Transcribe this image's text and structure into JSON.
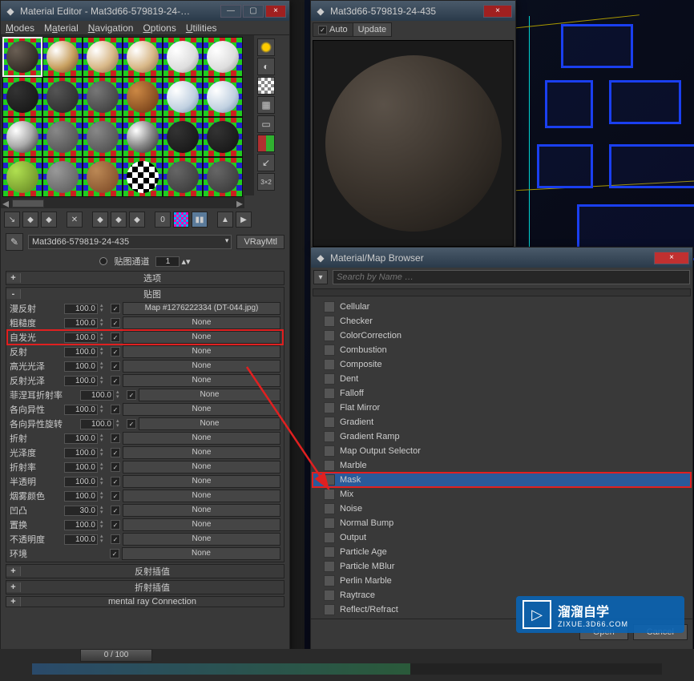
{
  "material_editor": {
    "title": "Material Editor - Mat3d66-579819-24-…",
    "menus": [
      "Modes",
      "Material",
      "Navigation",
      "Options",
      "Utilities"
    ],
    "material_name": "Mat3d66-579819-24-435",
    "material_type": "VRayMtl",
    "channel_label": "贴图通道",
    "channel_value": "1",
    "rollouts": {
      "options": {
        "sign": "+",
        "title": "选项"
      },
      "maps": {
        "sign": "-",
        "title": "贴图"
      },
      "refl_interp": {
        "sign": "+",
        "title": "反射插值"
      },
      "refr_interp": {
        "sign": "+",
        "title": "折射插值"
      },
      "mental_ray": {
        "sign": "+",
        "title": "mental ray Connection"
      }
    },
    "maps": [
      {
        "label": "漫反射",
        "amount": "100.0",
        "checked": true,
        "slot": "Map #1276222334 (DT-044.jpg)"
      },
      {
        "label": "粗糙度",
        "amount": "100.0",
        "checked": true,
        "slot": "None"
      },
      {
        "label": "自发光",
        "amount": "100.0",
        "checked": true,
        "slot": "None",
        "highlight": true
      },
      {
        "label": "反射",
        "amount": "100.0",
        "checked": true,
        "slot": "None"
      },
      {
        "label": "高光光泽",
        "amount": "100.0",
        "checked": true,
        "slot": "None"
      },
      {
        "label": "反射光泽",
        "amount": "100.0",
        "checked": true,
        "slot": "None"
      },
      {
        "label": "菲涅耳折射率",
        "amount": "100.0",
        "checked": true,
        "slot": "None",
        "indent": true
      },
      {
        "label": "各向异性",
        "amount": "100.0",
        "checked": true,
        "slot": "None"
      },
      {
        "label": "各向异性旋转",
        "amount": "100.0",
        "checked": true,
        "slot": "None",
        "indent": true
      },
      {
        "label": "折射",
        "amount": "100.0",
        "checked": true,
        "slot": "None"
      },
      {
        "label": "光泽度",
        "amount": "100.0",
        "checked": true,
        "slot": "None"
      },
      {
        "label": "折射率",
        "amount": "100.0",
        "checked": true,
        "slot": "None"
      },
      {
        "label": "半透明",
        "amount": "100.0",
        "checked": true,
        "slot": "None"
      },
      {
        "label": "烟雾颜色",
        "amount": "100.0",
        "checked": true,
        "slot": "None"
      },
      {
        "label": "凹凸",
        "amount": "30.0",
        "checked": true,
        "slot": "None"
      },
      {
        "label": "置换",
        "amount": "100.0",
        "checked": true,
        "slot": "None"
      },
      {
        "label": "不透明度",
        "amount": "100.0",
        "checked": true,
        "slot": "None"
      },
      {
        "label": "环境",
        "amount": "",
        "checked": true,
        "slot": "None",
        "no_amount": true
      }
    ]
  },
  "preview": {
    "title": "Mat3d66-579819-24-435",
    "auto": "Auto",
    "update": "Update",
    "auto_checked": true
  },
  "browser": {
    "title": "Material/Map Browser",
    "search_placeholder": "Search by Name …",
    "items": [
      {
        "name": "Cellular"
      },
      {
        "name": "Checker"
      },
      {
        "name": "ColorCorrection"
      },
      {
        "name": "Combustion"
      },
      {
        "name": "Composite"
      },
      {
        "name": "Dent"
      },
      {
        "name": "Falloff"
      },
      {
        "name": "Flat Mirror"
      },
      {
        "name": "Gradient"
      },
      {
        "name": "Gradient Ramp"
      },
      {
        "name": "Map Output Selector"
      },
      {
        "name": "Marble"
      },
      {
        "name": "Mask",
        "selected": true,
        "highlight": true
      },
      {
        "name": "Mix"
      },
      {
        "name": "Noise"
      },
      {
        "name": "Normal Bump"
      },
      {
        "name": "Output"
      },
      {
        "name": "Particle Age"
      },
      {
        "name": "Particle MBlur"
      },
      {
        "name": "Perlin Marble"
      },
      {
        "name": "Raytrace"
      },
      {
        "name": "Reflect/Refract"
      }
    ],
    "open_btn": "Open",
    "cancel_btn": "Cancel"
  },
  "timeline": {
    "slider": "0 / 100"
  },
  "watermark": {
    "big": "溜溜自学",
    "small": "ZIXUE.3D66.COM"
  }
}
